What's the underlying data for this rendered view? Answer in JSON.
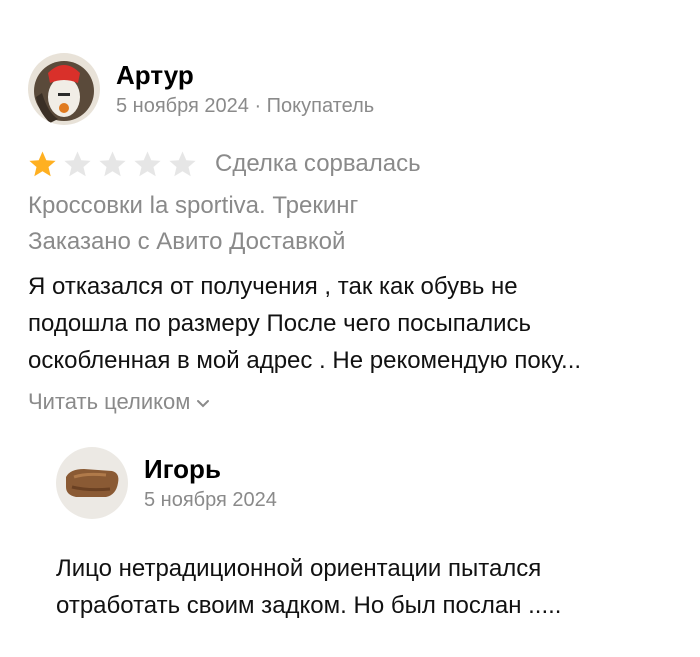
{
  "review": {
    "author_name": "Артур",
    "date_role": "5 ноября 2024 · Покупатель",
    "rating": 1,
    "rating_max": 5,
    "deal_status": "Сделка сорвалась",
    "product": "Кроссовки la sportiva. Трекинг",
    "delivery": "Заказано с Авито Доставкой",
    "text_lines": [
      "Я отказался от получения , так как обувь не",
      "подошла по размеру После чего посыпались",
      "оскобленная в мой адрес . Не рекомендую  поку..."
    ],
    "read_more": "Читать целиком",
    "colors": {
      "star_filled": "#FFB021",
      "star_empty": "#E6E6E6",
      "secondary_text": "#8A8A8A"
    }
  },
  "reply": {
    "author_name": "Игорь",
    "date": "5 ноября 2024",
    "text_lines": [
      "Лицо нетрадиционной ориентации пытался",
      "отработать своим задком. Но был послан ....."
    ]
  }
}
